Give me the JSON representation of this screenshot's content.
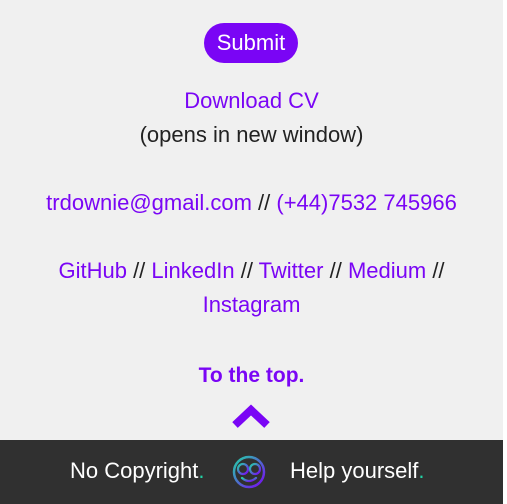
{
  "form": {
    "submit_label": "Submit"
  },
  "cv": {
    "download_label": "Download CV",
    "note": "(opens in new window)"
  },
  "contact": {
    "email": "trdownie@gmail.com",
    "separator": "//",
    "phone": "(+44)7532 745966"
  },
  "social": {
    "github": "GitHub",
    "linkedin": "LinkedIn",
    "twitter": "Twitter",
    "medium": "Medium",
    "instagram": "Instagram",
    "separator": "//"
  },
  "nav": {
    "to_top_label": "To the top."
  },
  "footer": {
    "left_text": "No Copyright",
    "right_text": "Help yourself",
    "period": ".",
    "background": "#303030",
    "dot_color": "#22d3a6"
  },
  "colors": {
    "accent": "#7a05f5",
    "page_bg": "#f0f0f0"
  },
  "icons": {
    "avatar": "smiling-face-with-glasses-icon",
    "chevron": "chevron-up-icon"
  }
}
